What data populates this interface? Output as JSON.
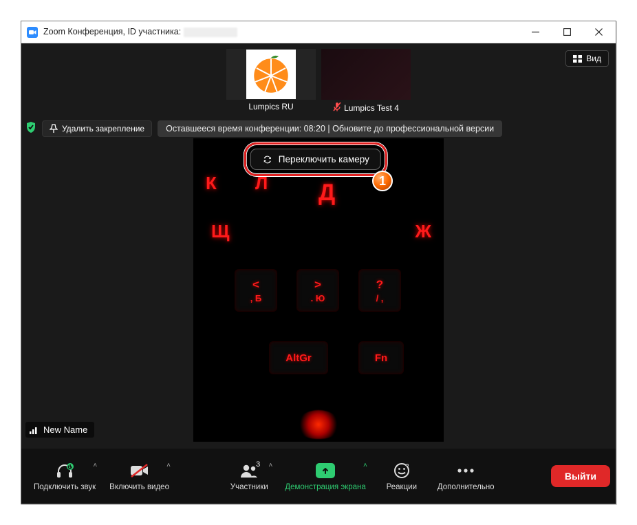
{
  "titlebar": {
    "title": "Zoom Конференция, ID участника:"
  },
  "view_button": "Вид",
  "thumbs": [
    {
      "name": "Lumpics RU",
      "avatar": "orange",
      "muted": false
    },
    {
      "name": "Lumpics Test 4",
      "avatar": "dark",
      "muted": true
    }
  ],
  "pin": {
    "label": "Удалить закрепление"
  },
  "timebar": "Оставшееся время конференции: 08:20 | Обновите до профессиональной версии",
  "switch_camera": "Переключить камеру",
  "badge": "1",
  "participant_name": "New Name",
  "toolbar": {
    "audio": "Подключить звук",
    "video": "Включить видео",
    "participants": "Участники",
    "participants_count": "3",
    "share": "Демонстрация экрана",
    "reactions": "Реакции",
    "more": "Дополнительно",
    "leave": "Выйти"
  }
}
